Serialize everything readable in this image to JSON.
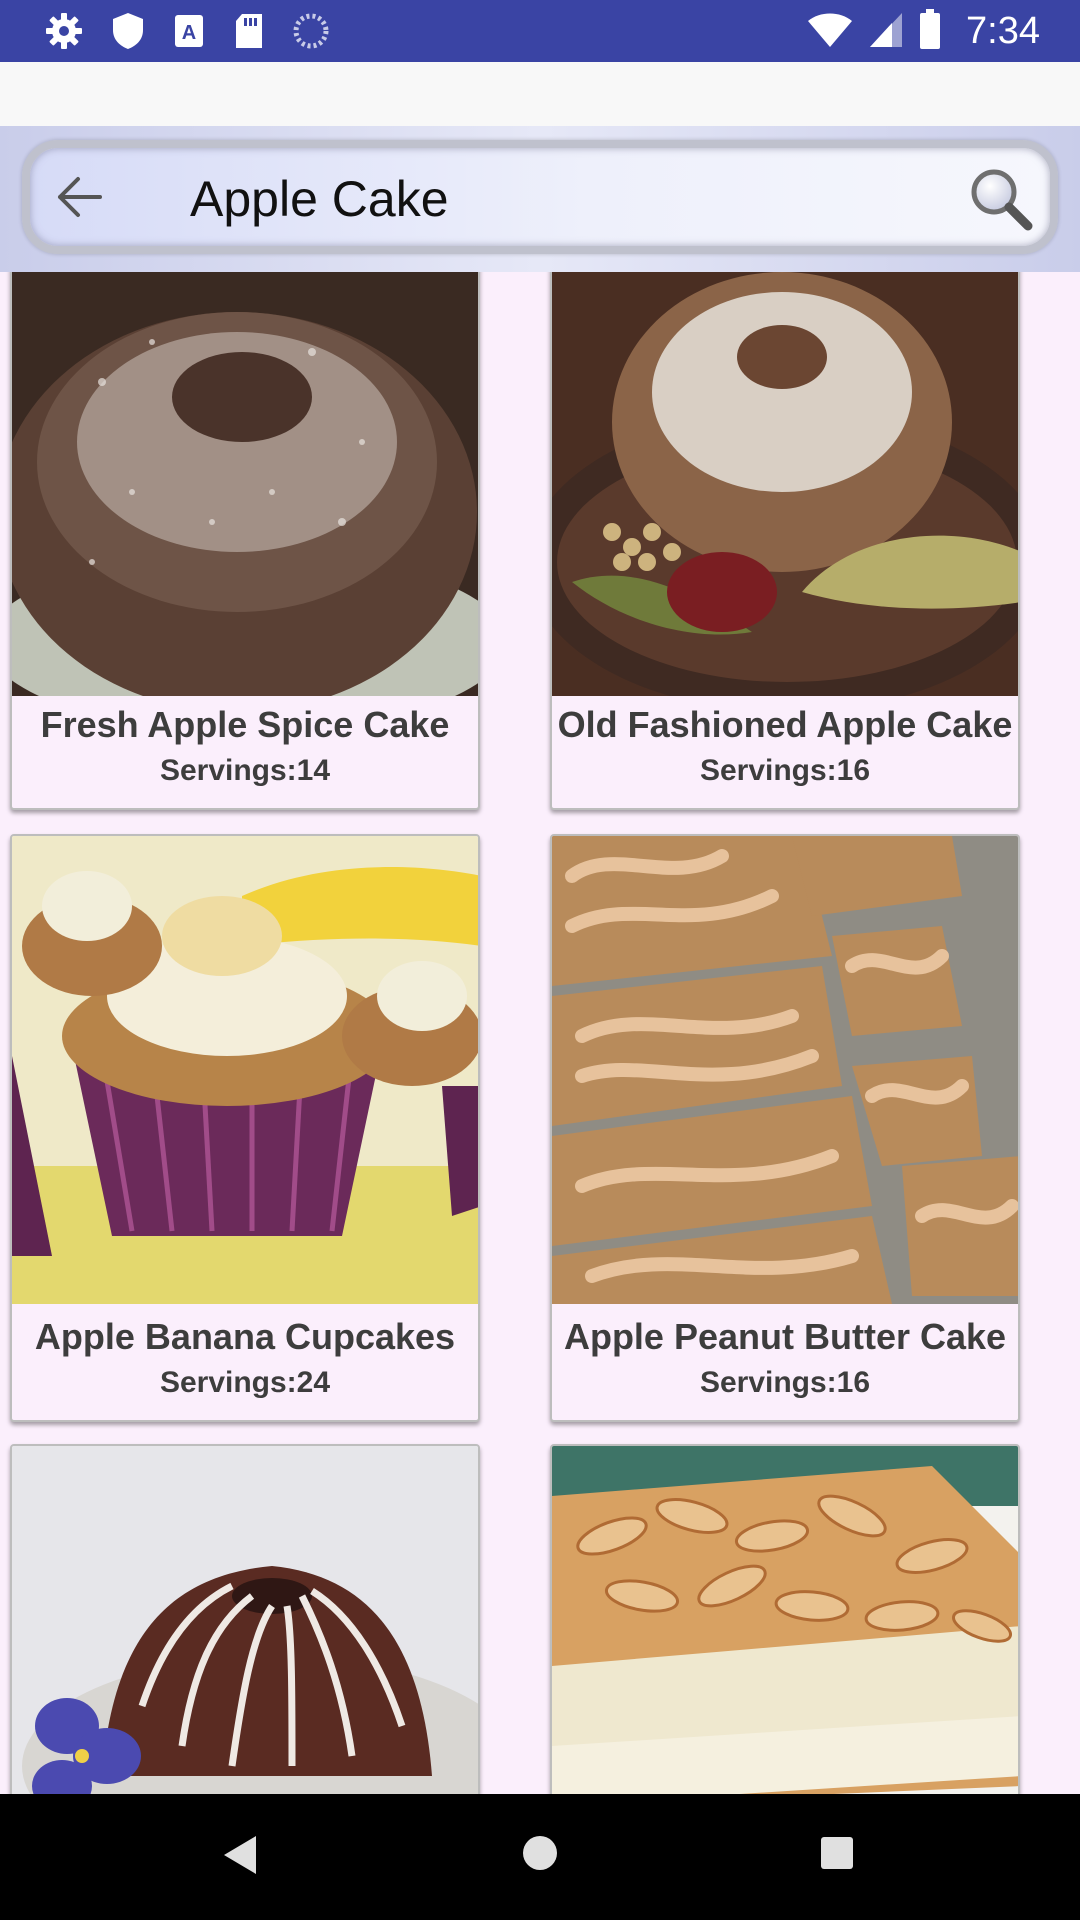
{
  "status_bar": {
    "time": "7:34",
    "icons_left": [
      "settings-icon",
      "shield-icon",
      "keyboard-a-icon",
      "sd-card-icon",
      "loading-icon"
    ],
    "icons_right": [
      "wifi-icon",
      "signal-icon",
      "battery-icon"
    ]
  },
  "search": {
    "query": "Apple Cake"
  },
  "recipes": [
    {
      "title": "Fresh Apple Spice Cake",
      "servings": "Servings:14"
    },
    {
      "title": "Old Fashioned Apple Cake",
      "servings": "Servings:16"
    },
    {
      "title": "Apple Banana Cupcakes",
      "servings": "Servings:24"
    },
    {
      "title": "Apple Peanut Butter Cake",
      "servings": "Servings:16"
    },
    {
      "title": "",
      "servings": ""
    },
    {
      "title": "",
      "servings": ""
    }
  ],
  "colors": {
    "status_bar": "#3a44a4",
    "background": "#fbeffc",
    "card_text": "#3d3d3d"
  }
}
